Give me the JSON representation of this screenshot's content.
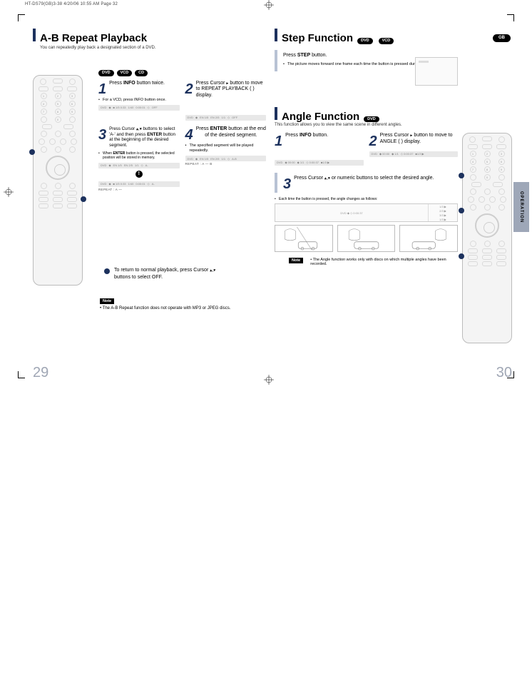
{
  "print_header": "HT-DS79(GB)3-38  4/20/06 10:55 AM  Page 32",
  "left_page": {
    "title": "A-B Repeat Playback",
    "subtitle": "You can repeatedly play back a designated section of a DVD.",
    "disc_pills": [
      "DVD",
      "VCD",
      "CD"
    ],
    "step1": {
      "num": "1",
      "text_a": "Press ",
      "bold": "INFO",
      "text_b": " button twice."
    },
    "step2": {
      "num": "2",
      "text_a": "Press Cursor ",
      "text_b": " button to move to REPEAT PLAYBACK (        ) display."
    },
    "vcd_tip": "For a VCD, press INFO button once.",
    "status_off": "OFF",
    "step3": {
      "num": "3",
      "text_a": "Press Cursor ",
      "text_b": " buttons to select 'A-' and then press ",
      "bold": "ENTER",
      "text_c": " button at the beginning of the desired segment."
    },
    "enter_tip": "When ENTER button is pressed, the selected position will be stored in memory.",
    "step4": {
      "num": "4",
      "text_a": "Press ",
      "bold": "ENTER",
      "text_b": " button at the end of the desired segment."
    },
    "spec_tip": "The specified segment will be played repeatedly.",
    "repeat_a": "REPEAT : A —",
    "repeat_ab": "REPEAT : A — B",
    "status_badge_a": "A-",
    "status_badge_ab": "A-B",
    "return_text_a": "To return to normal playback, press Cursor ",
    "return_text_b": " buttons to select       OFF.",
    "note_label": "Note",
    "note_text": "The A-B Repeat function does not operate with MP3 or JPEG discs.",
    "page_num": "29"
  },
  "right_page": {
    "gb": "GB",
    "step_fn": {
      "title": "Step Function",
      "pills": [
        "DVD",
        "VCD"
      ],
      "instr_a": "Press ",
      "instr_bold": "STEP",
      "instr_b": " button.",
      "bullet": "The picture moves forward one frame each time the button is pressed during playback."
    },
    "angle_fn": {
      "title": "Angle Function",
      "pills": [
        "DVD"
      ],
      "subtitle": "This function allows you to view the same scene in different angles.",
      "step1": {
        "num": "1",
        "text_a": "Press ",
        "bold": "INFO",
        "text_b": " button."
      },
      "step2": {
        "num": "2",
        "text_a": "Press Cursor ",
        "text_b": " button to move to ANGLE (      ) display."
      },
      "step3": {
        "num": "3",
        "text_a": "Press Cursor ",
        "text_b": " or numeric buttons to select the desired angle."
      },
      "each_time": "Each time the button is pressed, the angle changes as follows:",
      "seq": [
        "1/3 ▶",
        "2/3 ▶",
        "3/3 ▶",
        "1/3 ▶"
      ],
      "note_label": "Note",
      "note_text": "The Angle function works only with discs on which multiple angles have been recorded."
    },
    "side_tab": "OPERATION",
    "page_num": "30"
  }
}
